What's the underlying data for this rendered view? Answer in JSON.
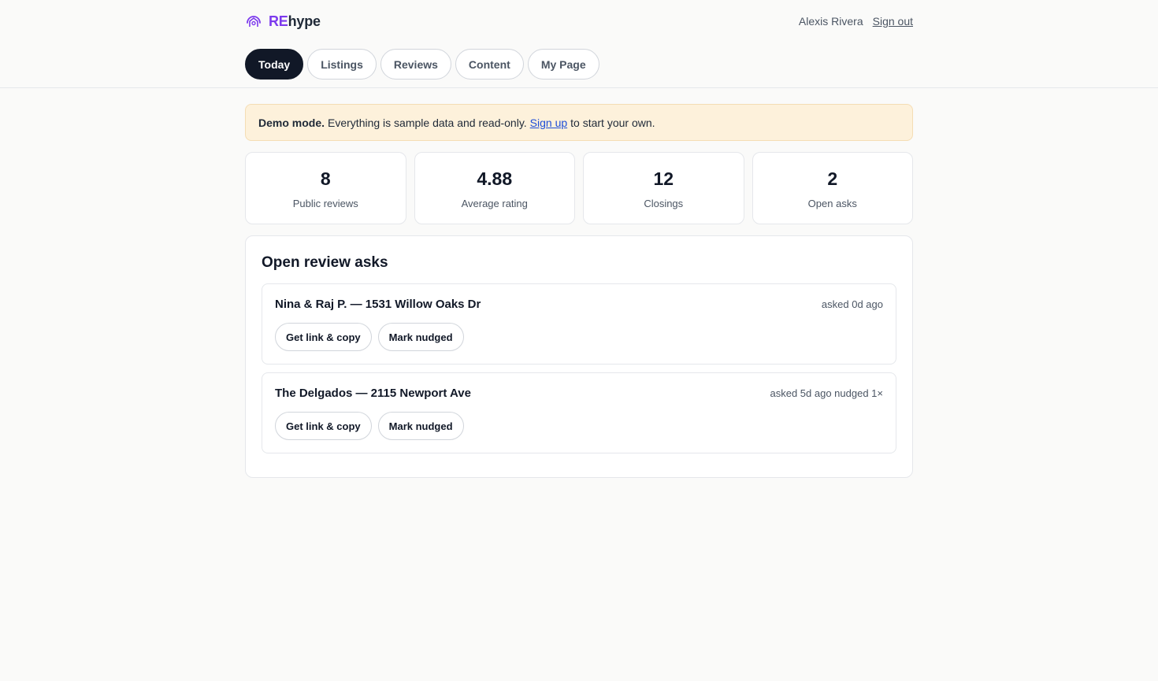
{
  "brand": {
    "logo_icon": "house-radar-icon",
    "name_accent": "RE",
    "name_rest": "hype",
    "accent_color": "#7c3aed"
  },
  "user": {
    "name": "Alexis Rivera",
    "signout_label": "Sign out"
  },
  "tabs": [
    {
      "label": "Today",
      "active": true
    },
    {
      "label": "Listings",
      "active": false
    },
    {
      "label": "Reviews",
      "active": false
    },
    {
      "label": "Content",
      "active": false
    },
    {
      "label": "My Page",
      "active": false
    }
  ],
  "banner": {
    "strong": "Demo mode.",
    "text_before": "Everything is sample data and read-only.",
    "link_label": "Sign up",
    "text_after": "to start your own."
  },
  "stats": [
    {
      "value": "8",
      "label": "Public reviews"
    },
    {
      "value": "4.88",
      "label": "Average rating"
    },
    {
      "value": "12",
      "label": "Closings"
    },
    {
      "value": "2",
      "label": "Open asks"
    }
  ],
  "panel": {
    "title": "Open review asks",
    "asks": [
      {
        "title": "Nina & Raj P. — 1531 Willow Oaks Dr",
        "meta": "asked 0d ago",
        "copy_label": "Get link & copy",
        "nudge_label": "Mark nudged"
      },
      {
        "title": "The Delgados — 2115 Newport Ave",
        "meta": "asked 5d ago nudged 1×",
        "copy_label": "Get link & copy",
        "nudge_label": "Mark nudged"
      }
    ]
  }
}
